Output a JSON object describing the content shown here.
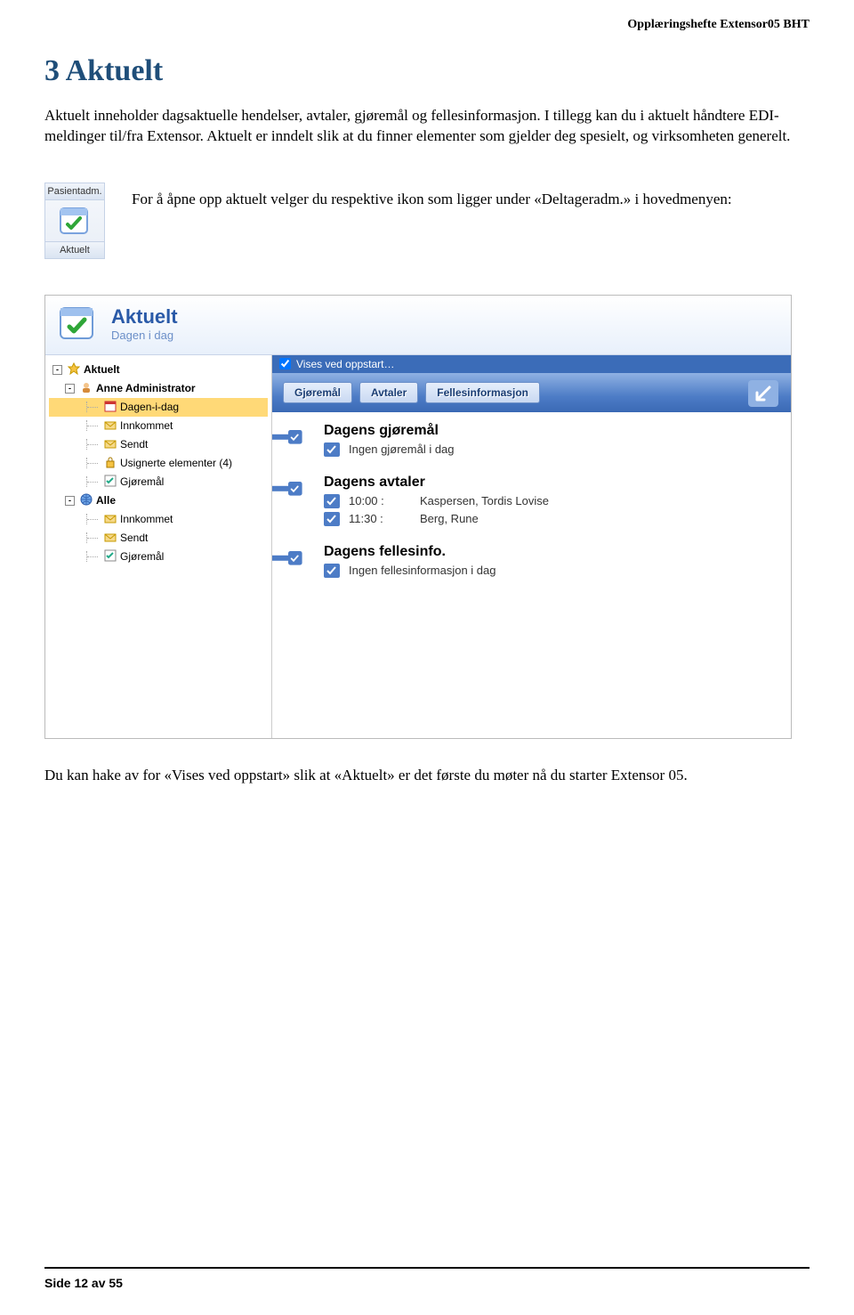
{
  "doc": {
    "header": "Opplæringshefte Extensor05 BHT",
    "heading": "3 Aktuelt",
    "para1": "Aktuelt inneholder dagsaktuelle hendelser, avtaler, gjøremål og fellesinformasjon. I tillegg kan du i aktuelt håndtere EDI-meldinger til/fra Extensor. Aktuelt er inndelt slik at du finner elementer som gjelder deg spesielt, og virksomheten generelt.",
    "para2": "For å åpne opp aktuelt velger du respektive ikon som ligger under «Deltageradm.» i hovedmenyen:",
    "para3": "Du kan hake av for «Vises ved oppstart» slik at «Aktuelt» er det første du møter nå du starter Extensor 05.",
    "footer": "Side 12 av 55"
  },
  "smallmenu": {
    "top": "Pasientadm.",
    "bottom": "Aktuelt"
  },
  "app": {
    "title": "Aktuelt",
    "subtitle": "Dagen i dag",
    "topbar_label": "Vises ved oppstart…",
    "tabs": [
      "Gjøremål",
      "Avtaler",
      "Fellesinformasjon"
    ],
    "tree": [
      {
        "label": "Aktuelt",
        "indent": 0,
        "bold": true,
        "toggle": "-",
        "icon": "star"
      },
      {
        "label": "Anne Administrator",
        "indent": 1,
        "bold": true,
        "toggle": "-",
        "icon": "user"
      },
      {
        "label": "Dagen-i-dag",
        "indent": 2,
        "icon": "calendar",
        "highlight": true
      },
      {
        "label": "Innkommet",
        "indent": 2,
        "icon": "mail-in"
      },
      {
        "label": "Sendt",
        "indent": 2,
        "icon": "mail-out"
      },
      {
        "label": "Usignerte elementer (4)",
        "indent": 2,
        "icon": "lock"
      },
      {
        "label": "Gjøremål",
        "indent": 2,
        "icon": "check"
      },
      {
        "label": "Alle",
        "indent": 1,
        "bold": true,
        "toggle": "-",
        "icon": "globe"
      },
      {
        "label": "Innkommet",
        "indent": 2,
        "icon": "mail-in"
      },
      {
        "label": "Sendt",
        "indent": 2,
        "icon": "mail-out"
      },
      {
        "label": "Gjøremål",
        "indent": 2,
        "icon": "check"
      }
    ],
    "sections": {
      "gjoremal": {
        "heading": "Dagens gjøremål",
        "empty": "Ingen gjøremål i dag"
      },
      "avtaler": {
        "heading": "Dagens avtaler",
        "rows": [
          {
            "time": "10:00 :",
            "name": "Kaspersen, Tordis Lovise"
          },
          {
            "time": "11:30 :",
            "name": "Berg, Rune"
          }
        ]
      },
      "felles": {
        "heading": "Dagens fellesinfo.",
        "empty": "Ingen fellesinformasjon i dag"
      }
    }
  }
}
